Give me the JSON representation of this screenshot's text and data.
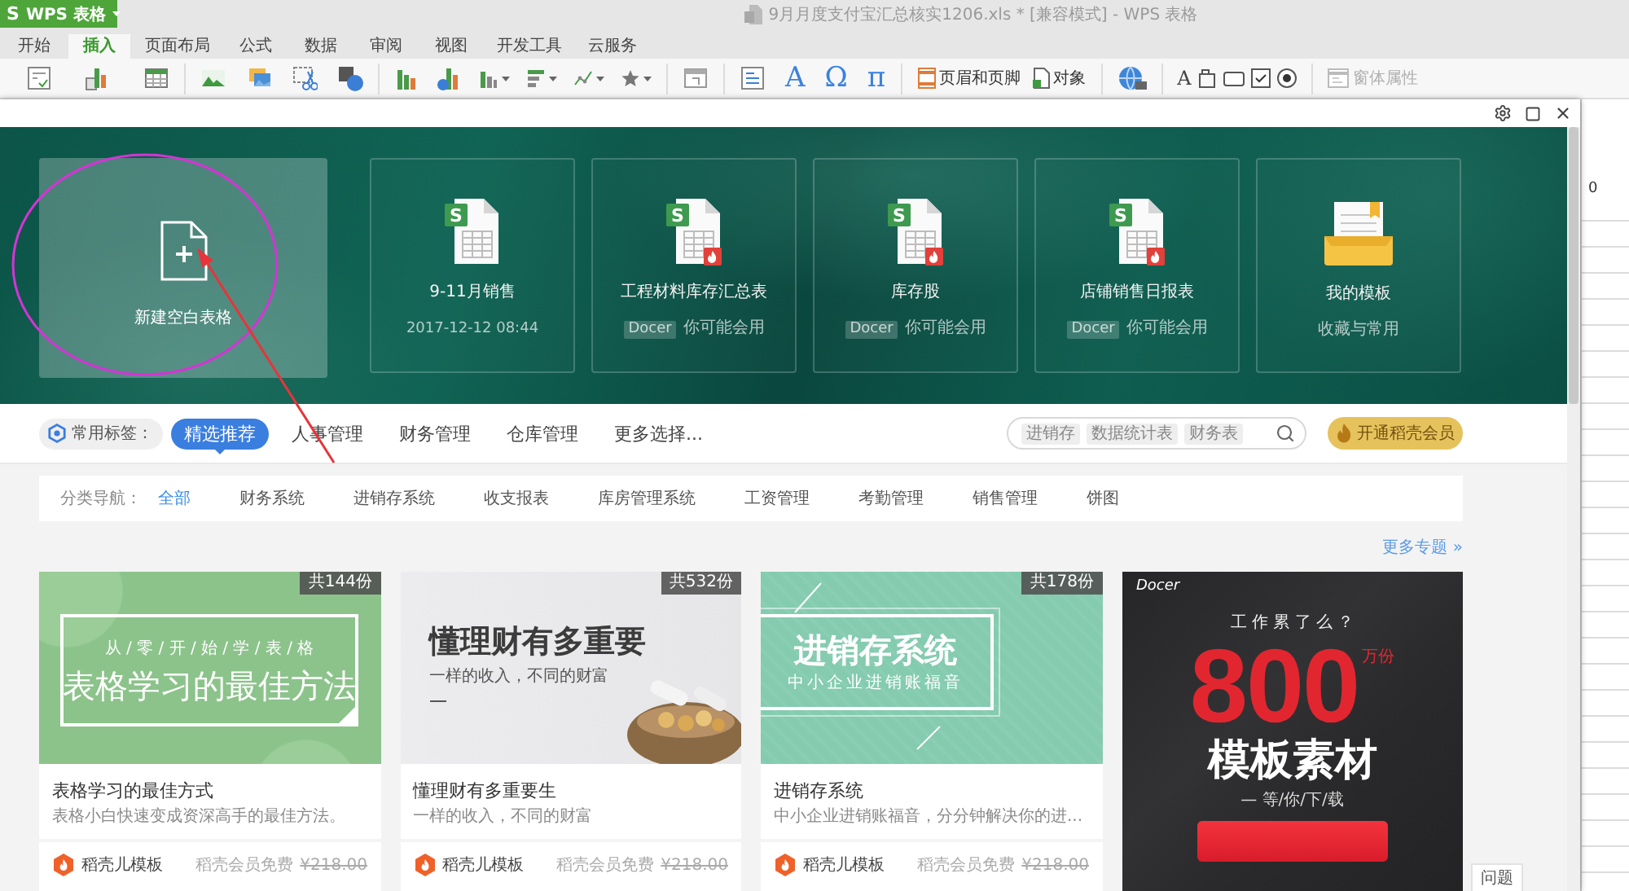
{
  "app_button": {
    "logo": "S",
    "label": "WPS 表格"
  },
  "window": {
    "title": "9月月度支付宝汇总核实1206.xls * [兼容模式] - WPS 表格"
  },
  "menu_tabs": [
    {
      "label": "开始",
      "selected": false
    },
    {
      "label": "插入",
      "selected": true
    },
    {
      "label": "页面布局",
      "selected": false
    },
    {
      "label": "公式",
      "selected": false
    },
    {
      "label": "数据",
      "selected": false
    },
    {
      "label": "审阅",
      "selected": false
    },
    {
      "label": "视图",
      "selected": false
    },
    {
      "label": "开发工具",
      "selected": false
    },
    {
      "label": "云服务",
      "selected": false
    }
  ],
  "toolbar": {
    "glyphs": [
      {
        "kind": "wordart",
        "text": "A"
      },
      {
        "kind": "symbol",
        "text": "Ω"
      },
      {
        "kind": "equation",
        "text": "π"
      },
      {
        "kind": "label",
        "text": "A"
      }
    ],
    "buttons": [
      {
        "kind": "header_footer",
        "label": "页眉和页脚",
        "disabled": false
      },
      {
        "kind": "object",
        "label": "对象",
        "disabled": false
      },
      {
        "kind": "form_properties",
        "label": "窗体属性",
        "disabled": true
      }
    ]
  },
  "hero": {
    "cards": [
      {
        "kind": "new",
        "title": "新建空白表格"
      },
      {
        "kind": "recent",
        "glyph": "S",
        "title": "9-11月销售",
        "subtitle": "2017-12-12 08:44"
      },
      {
        "kind": "docer",
        "glyph": "S",
        "title": "工程材料库存汇总表",
        "tag": "Docer",
        "subtitle": "你可能会用"
      },
      {
        "kind": "docer",
        "glyph": "S",
        "title": "库存股",
        "tag": "Docer",
        "subtitle": "你可能会用"
      },
      {
        "kind": "docer",
        "glyph": "S",
        "title": "店铺销售日报表",
        "tag": "Docer",
        "subtitle": "你可能会用"
      },
      {
        "kind": "templates",
        "title": "我的模板",
        "subtitle": "收藏与常用"
      }
    ]
  },
  "tag_bar": {
    "label": "常用标签：",
    "tabs": [
      {
        "label": "精选推荐",
        "selected": true
      },
      {
        "label": "人事管理",
        "selected": false
      },
      {
        "label": "财务管理",
        "selected": false
      },
      {
        "label": "仓库管理",
        "selected": false
      },
      {
        "label": "更多选择...",
        "selected": false
      }
    ],
    "search": {
      "chips": [
        "进销存",
        "数据统计表",
        "财务表"
      ]
    },
    "vip_button": "开通稻壳会员"
  },
  "category_nav": {
    "label": "分类导航：",
    "items": [
      {
        "label": "全部",
        "selected": true
      },
      {
        "label": "财务系统",
        "selected": false
      },
      {
        "label": "进销存系统",
        "selected": false
      },
      {
        "label": "收支报表",
        "selected": false
      },
      {
        "label": "库房管理系统",
        "selected": false
      },
      {
        "label": "工资管理",
        "selected": false
      },
      {
        "label": "考勤管理",
        "selected": false
      },
      {
        "label": "销售管理",
        "selected": false
      },
      {
        "label": "饼图",
        "selected": false
      }
    ]
  },
  "more_link": "更多专题 »",
  "templates": [
    {
      "kind": "template",
      "banner": {
        "kind": "framed",
        "kicker": "从 / 零 / 开 / 始 / 学 / 表 / 格",
        "headline": "表格学习的最佳方法"
      },
      "count": "共144份",
      "title": "表格学习的最佳方式",
      "description": "表格小白快速变成资深高手的最佳方法。",
      "publisher": "稻壳儿模板",
      "price_note": "稻壳会员免费",
      "price": "¥218.00"
    },
    {
      "kind": "template",
      "banner": {
        "kind": "photo",
        "headline": "懂理财有多重要",
        "subline": "一样的收入，不同的财富"
      },
      "count": "共532份",
      "title": "懂理财有多重要生",
      "description": "一样的收入，不同的财富",
      "publisher": "稻壳儿模板",
      "price_note": "稻壳会员免费",
      "price": "¥218.00"
    },
    {
      "kind": "template",
      "banner": {
        "kind": "lines",
        "headline": "进销存系统",
        "subline": "中小企业进销账福音"
      },
      "count": "共178份",
      "title": "进销存系统",
      "description": "中小企业进销账福音，分分钟解决你的进...",
      "publisher": "稻壳儿模板",
      "price_note": "稻壳会员免费",
      "price": "¥218.00"
    },
    {
      "kind": "ad",
      "logo": "Docer",
      "question": "工 作 累 了 么 ？",
      "number": "800",
      "unit": "万份",
      "headline": "模板素材",
      "tagline": "— 等/你/下/载"
    }
  ],
  "feedback_button": "问题",
  "sheet": {
    "cell": "0"
  }
}
